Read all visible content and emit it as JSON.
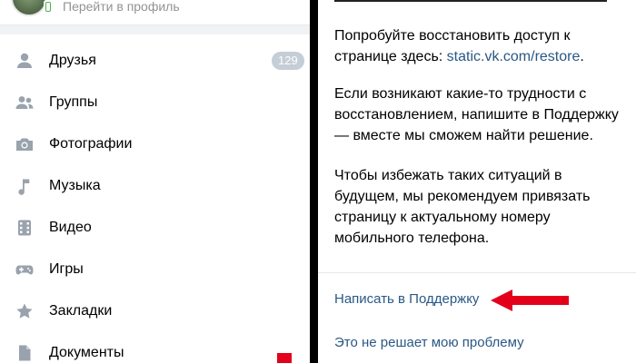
{
  "profile": {
    "link_label": "Перейти в профиль"
  },
  "menu": {
    "items": [
      {
        "label": "Друзья",
        "icon": "person-icon",
        "counter": "129"
      },
      {
        "label": "Группы",
        "icon": "group-icon"
      },
      {
        "label": "Фотографии",
        "icon": "camera-icon"
      },
      {
        "label": "Музыка",
        "icon": "music-note-icon"
      },
      {
        "label": "Видео",
        "icon": "film-icon"
      },
      {
        "label": "Игры",
        "icon": "gamepad-icon"
      },
      {
        "label": "Закладки",
        "icon": "star-icon"
      },
      {
        "label": "Документы",
        "icon": "document-icon"
      }
    ]
  },
  "help": {
    "p1_text": "Попробуйте восстановить доступ к странице здесь: ",
    "p1_link": "static.vk.com/restore",
    "p1_end": ".",
    "p2": "Если возникают какие-то трудности с восстановлением, напишите в Поддержку — вместе мы сможем найти решение.",
    "p3": "Чтобы избежать таких ситуаций в будущем, мы рекомендуем привязать страницу к актуальному номеру мобильного телефона.",
    "action_support": "Написать в Поддержку",
    "action_not_solved": "Это не решает мою проблему"
  },
  "colors": {
    "link": "#2a5885",
    "arrow": "#e3001b",
    "counter_bg": "#c5cdd6",
    "icon": "#99a2ad"
  }
}
